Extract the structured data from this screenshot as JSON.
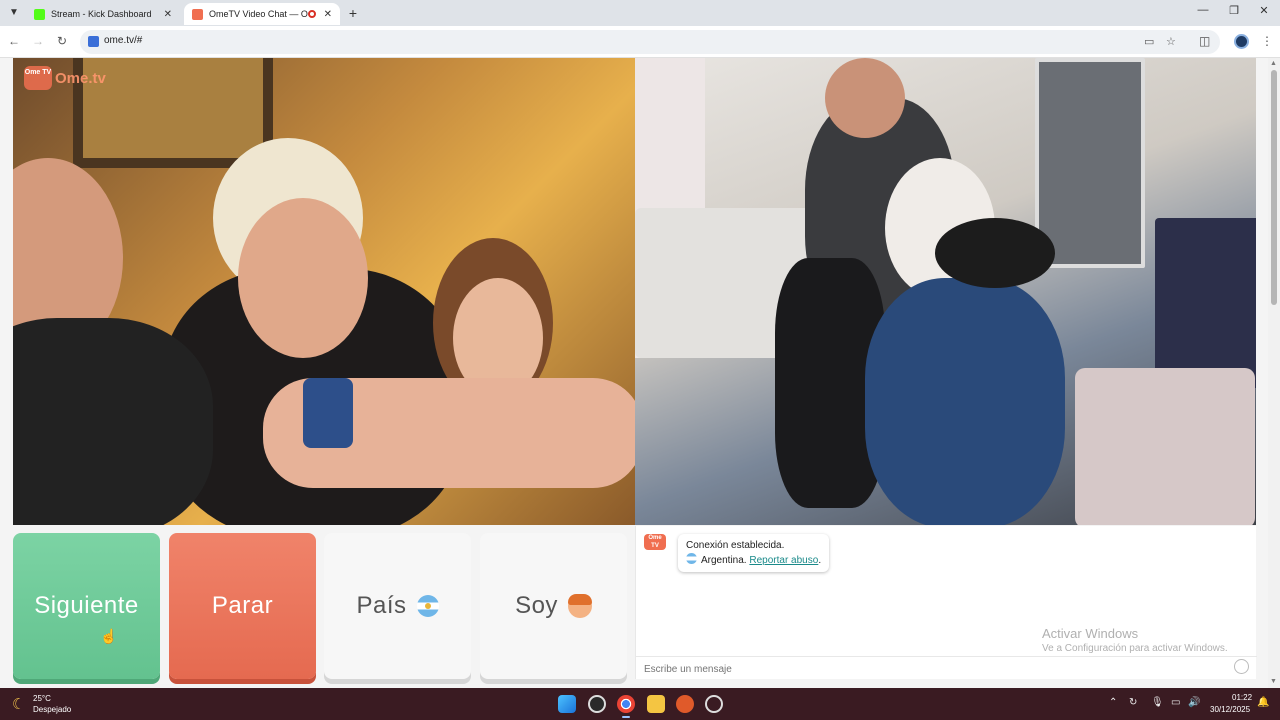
{
  "browser": {
    "tabs": [
      {
        "title": "Stream - Kick Dashboard",
        "favicon_color": "#53fc18",
        "active": false
      },
      {
        "title": "OmeTV Video Chat — Ome",
        "favicon_color": "#f06e50",
        "active": true
      }
    ],
    "url": "ome.tv/#",
    "icons": {
      "back": "back-arrow-icon",
      "forward": "forward-arrow-icon",
      "reload": "reload-icon",
      "cast": "cast-icon",
      "bookmark": "star-icon",
      "extensions": "puzzle-icon",
      "menu": "kebab-menu-icon"
    }
  },
  "page": {
    "logo": {
      "badge": "Ome TV",
      "text": "Ome.tv"
    },
    "buttons": {
      "next": "Siguiente",
      "stop": "Parar",
      "country": "País",
      "gender": "Soy"
    },
    "chat": {
      "avatar": "Ome TV",
      "connection": "Conexión establecida.",
      "country": "Argentina.",
      "report": "Reportar abuso",
      "period": ".",
      "placeholder": "Escribe un mensaje"
    },
    "watermark": {
      "title": "Activar Windows",
      "subtitle": "Ve a Configuración para activar Windows."
    },
    "colors": {
      "next": "#6dcb99",
      "stop": "#ea7459",
      "accent": "#f06e50"
    }
  },
  "taskbar": {
    "weather": {
      "temp": "25°C",
      "desc": "Despejado"
    },
    "clock": {
      "time": "01:22",
      "date": "30/12/2025"
    }
  }
}
